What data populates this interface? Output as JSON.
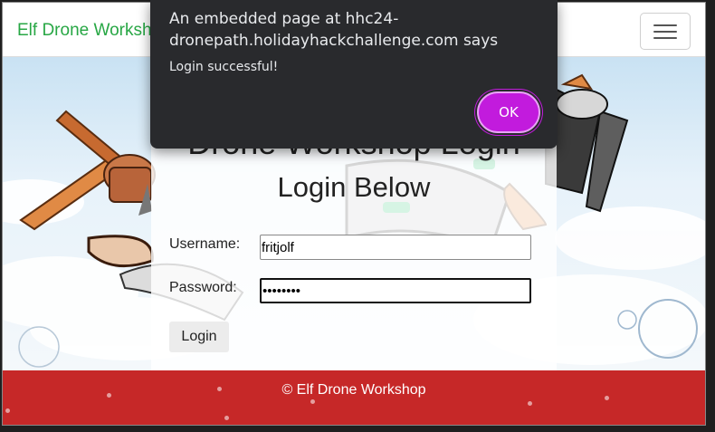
{
  "navbar": {
    "brand": "Elf Drone Workshop"
  },
  "page": {
    "heading": "Drone Workshop Login",
    "subheading": "Login Below"
  },
  "form": {
    "username_label": "Username:",
    "username_value": "fritjolf",
    "password_label": "Password:",
    "password_value": "••••••••",
    "login_label": "Login"
  },
  "footer": {
    "text": "© Elf Drone Workshop"
  },
  "dialog": {
    "title": "An embedded page at hhc24-dronepath.holidayhackchallenge.com says",
    "message": "Login successful!",
    "ok_label": "OK"
  },
  "colors": {
    "brand": "#28a745",
    "footer": "#c62828",
    "ok_button": "#c21bdd",
    "dialog_bg": "#292a2d"
  }
}
